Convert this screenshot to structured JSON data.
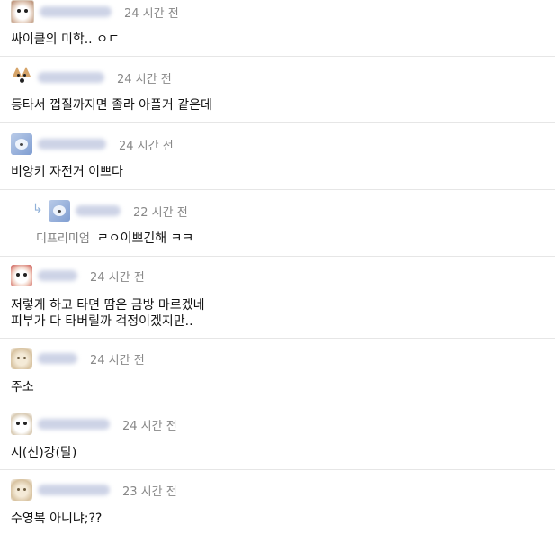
{
  "comments": [
    {
      "avatar": "dog-avatar-icon",
      "time": "24 시간 전",
      "text": "싸이클의 미학.. ㅇㄷ"
    },
    {
      "avatar": "fox-avatar-icon",
      "time": "24 시간 전",
      "text": "등타서 껍질까지면 졸라 아플거 같은데"
    },
    {
      "avatar": "blue-avatar-icon",
      "time": "24 시간 전",
      "text": "비앙키 자전거 이쁘다"
    },
    {
      "avatar": "blue-avatar-icon",
      "time": "22 시간 전",
      "reply_to": "디프리미엄",
      "text": "ㄹㅇ이쁘긴해 ㅋㅋ"
    },
    {
      "avatar": "red-dog-avatar-icon",
      "time": "24 시간 전",
      "text_line1": "저렇게 하고 타면 땀은 금방 마르겠네",
      "text_line2": "피부가 다 타버릴까 걱정이겠지만.."
    },
    {
      "avatar": "tan-dog-avatar-icon",
      "time": "24 시간 전",
      "text": "주소"
    },
    {
      "avatar": "puppy-avatar-icon",
      "time": "24 시간 전",
      "text": "시(선)강(탈)"
    },
    {
      "avatar": "tan-dog-avatar-icon",
      "time": "23 시간 전",
      "text": "수영복 아니냐;??"
    }
  ]
}
